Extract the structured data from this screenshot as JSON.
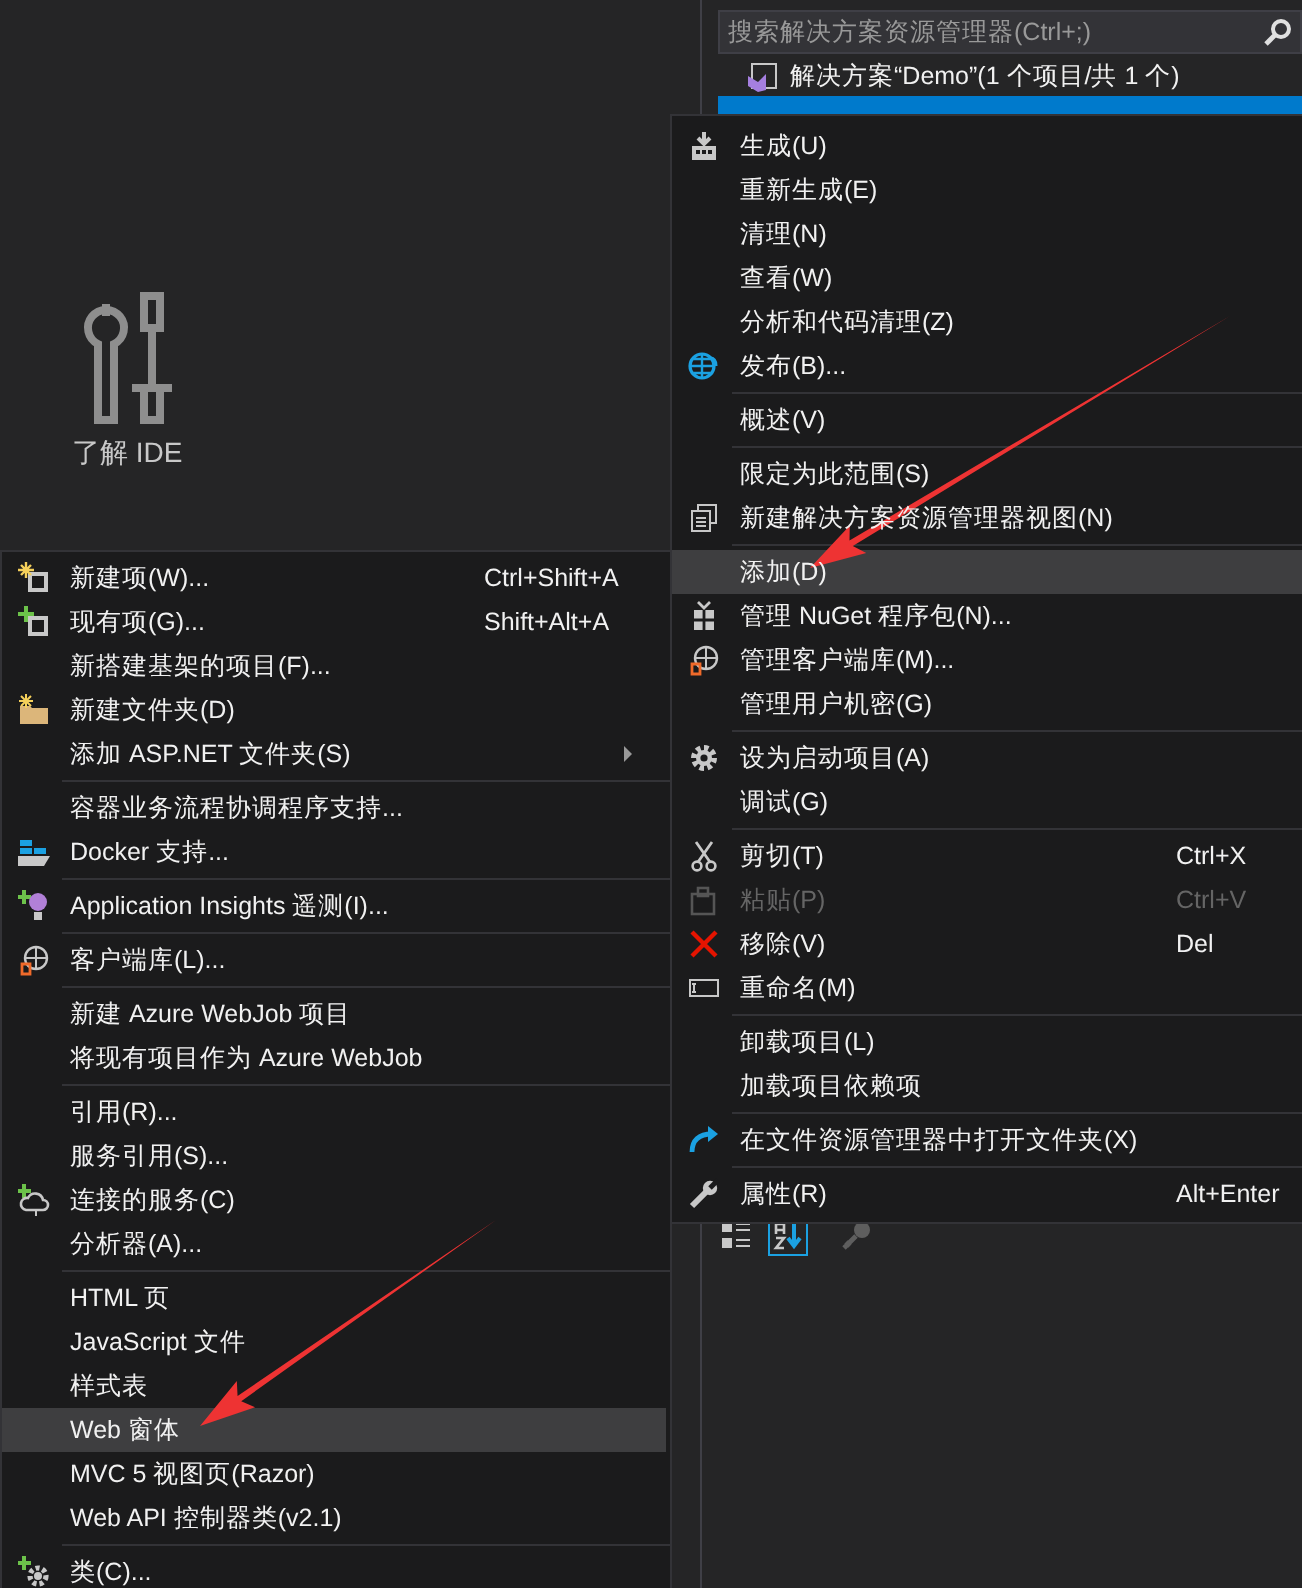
{
  "start_page": {
    "tile_label": "了解 IDE"
  },
  "solution_explorer": {
    "search": {
      "placeholder": "搜索解决方案资源管理器(Ctrl+;)"
    },
    "tree": [
      {
        "label": "解决方案“Demo”(1 个项目/共 1 个)",
        "selected": false,
        "children": [
          {
            "selected": true
          }
        ]
      }
    ],
    "property_toolbar": [
      {
        "kind": "categorized",
        "selected": false,
        "disabled": false
      },
      {
        "kind": "alphabetical",
        "selected": true,
        "disabled": false
      },
      {
        "kind": "property-pages",
        "selected": false,
        "disabled": true
      }
    ]
  },
  "context_menu": {
    "items": [
      {
        "kind": "item",
        "label": "生成(U)",
        "selected": false,
        "disabled": false
      },
      {
        "kind": "item",
        "label": "重新生成(E)",
        "selected": false,
        "disabled": false
      },
      {
        "kind": "item",
        "label": "清理(N)",
        "selected": false,
        "disabled": false
      },
      {
        "kind": "item",
        "label": "查看(W)",
        "selected": false,
        "disabled": false
      },
      {
        "kind": "item",
        "label": "分析和代码清理(Z)",
        "selected": false,
        "disabled": false
      },
      {
        "kind": "item",
        "label": "发布(B)...",
        "selected": false,
        "disabled": false
      },
      {
        "kind": "separator"
      },
      {
        "kind": "item",
        "label": "概述(V)",
        "selected": false,
        "disabled": false
      },
      {
        "kind": "separator"
      },
      {
        "kind": "item",
        "label": "限定为此范围(S)",
        "selected": false,
        "disabled": false
      },
      {
        "kind": "item",
        "label": "新建解决方案资源管理器视图(N)",
        "selected": false,
        "disabled": false
      },
      {
        "kind": "separator"
      },
      {
        "kind": "item",
        "label": "添加(D)",
        "selected": true,
        "disabled": false
      },
      {
        "kind": "item",
        "label": "管理 NuGet 程序包(N)...",
        "selected": false,
        "disabled": false
      },
      {
        "kind": "item",
        "label": "管理客户端库(M)...",
        "selected": false,
        "disabled": false
      },
      {
        "kind": "item",
        "label": "管理用户机密(G)",
        "selected": false,
        "disabled": false
      },
      {
        "kind": "separator"
      },
      {
        "kind": "item",
        "label": "设为启动项目(A)",
        "selected": false,
        "disabled": false
      },
      {
        "kind": "item",
        "label": "调试(G)",
        "selected": false,
        "disabled": false
      },
      {
        "kind": "separator"
      },
      {
        "kind": "item",
        "label": "剪切(T)",
        "shortcut": "Ctrl+X",
        "selected": false,
        "disabled": false
      },
      {
        "kind": "item",
        "label": "粘贴(P)",
        "shortcut": "Ctrl+V",
        "selected": false,
        "disabled": true
      },
      {
        "kind": "item",
        "label": "移除(V)",
        "shortcut": "Del",
        "selected": false,
        "disabled": false
      },
      {
        "kind": "item",
        "label": "重命名(M)",
        "selected": false,
        "disabled": false
      },
      {
        "kind": "separator"
      },
      {
        "kind": "item",
        "label": "卸载项目(L)",
        "selected": false,
        "disabled": false
      },
      {
        "kind": "item",
        "label": "加载项目依赖项",
        "selected": false,
        "disabled": false
      },
      {
        "kind": "separator"
      },
      {
        "kind": "item",
        "label": "在文件资源管理器中打开文件夹(X)",
        "selected": false,
        "disabled": false
      },
      {
        "kind": "separator"
      },
      {
        "kind": "item",
        "label": "属性(R)",
        "shortcut": "Alt+Enter",
        "selected": false,
        "disabled": false
      }
    ]
  },
  "add_submenu": {
    "items": [
      {
        "kind": "item",
        "label": "新建项(W)...",
        "shortcut": "Ctrl+Shift+A",
        "selected": false,
        "submenu": false
      },
      {
        "kind": "item",
        "label": "现有项(G)...",
        "shortcut": "Shift+Alt+A",
        "selected": false,
        "submenu": false
      },
      {
        "kind": "item",
        "label": "新搭建基架的项目(F)...",
        "selected": false,
        "submenu": false
      },
      {
        "kind": "item",
        "label": "新建文件夹(D)",
        "selected": false,
        "submenu": false
      },
      {
        "kind": "item",
        "label": "添加 ASP.NET 文件夹(S)",
        "selected": false,
        "submenu": true
      },
      {
        "kind": "separator"
      },
      {
        "kind": "item",
        "label": "容器业务流程协调程序支持...",
        "selected": false,
        "submenu": false
      },
      {
        "kind": "item",
        "label": "Docker 支持...",
        "selected": false,
        "submenu": false
      },
      {
        "kind": "separator"
      },
      {
        "kind": "item",
        "label": "Application Insights 遥测(I)...",
        "selected": false,
        "submenu": false
      },
      {
        "kind": "separator"
      },
      {
        "kind": "item",
        "label": "客户端库(L)...",
        "selected": false,
        "submenu": false
      },
      {
        "kind": "separator"
      },
      {
        "kind": "item",
        "label": "新建 Azure WebJob 项目",
        "selected": false,
        "submenu": false
      },
      {
        "kind": "item",
        "label": "将现有项目作为 Azure WebJob",
        "selected": false,
        "submenu": false
      },
      {
        "kind": "separator"
      },
      {
        "kind": "item",
        "label": "引用(R)...",
        "selected": false,
        "submenu": false
      },
      {
        "kind": "item",
        "label": "服务引用(S)...",
        "selected": false,
        "submenu": false
      },
      {
        "kind": "item",
        "label": "连接的服务(C)",
        "selected": false,
        "submenu": false
      },
      {
        "kind": "item",
        "label": "分析器(A)...",
        "selected": false,
        "submenu": false
      },
      {
        "kind": "separator"
      },
      {
        "kind": "item",
        "label": "HTML 页",
        "selected": false,
        "submenu": false
      },
      {
        "kind": "item",
        "label": "JavaScript 文件",
        "selected": false,
        "submenu": false
      },
      {
        "kind": "item",
        "label": "样式表",
        "selected": false,
        "submenu": false
      },
      {
        "kind": "item",
        "label": "Web 窗体",
        "selected": true,
        "submenu": false
      },
      {
        "kind": "item",
        "label": "MVC 5 视图页(Razor)",
        "selected": false,
        "submenu": false
      },
      {
        "kind": "item",
        "label": "Web API 控制器类(v2.1)",
        "selected": false,
        "submenu": false
      },
      {
        "kind": "separator"
      },
      {
        "kind": "item",
        "label": "类(C)...",
        "selected": false,
        "submenu": false
      }
    ]
  }
}
